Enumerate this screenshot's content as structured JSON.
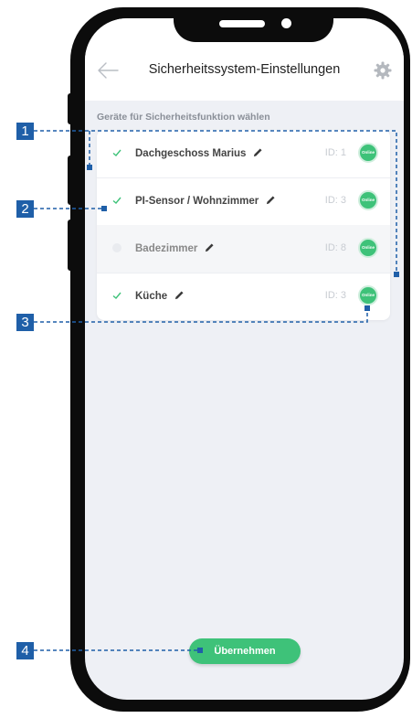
{
  "header": {
    "title": "Sicherheitssystem-Einstellungen",
    "back_icon": "arrow-left-icon",
    "settings_icon": "gear-icon"
  },
  "section_label": "Geräte für Sicherheitsfunktion wählen",
  "devices": [
    {
      "name": "Dachgeschoss Marius",
      "id": "ID: 1",
      "status": "Online",
      "checked": true
    },
    {
      "name": "PI-Sensor / Wohnzimmer",
      "id": "ID: 3",
      "status": "Online",
      "checked": true
    },
    {
      "name": "Badezimmer",
      "id": "ID: 8",
      "status": "Online",
      "checked": false
    },
    {
      "name": "Küche",
      "id": "ID: 3",
      "status": "Online",
      "checked": true
    }
  ],
  "apply_label": "Übernehmen",
  "callouts": [
    "1",
    "2",
    "3",
    "4"
  ],
  "colors": {
    "accent": "#3ec279",
    "callout": "#1f5fa8",
    "background": "#eef0f5"
  }
}
